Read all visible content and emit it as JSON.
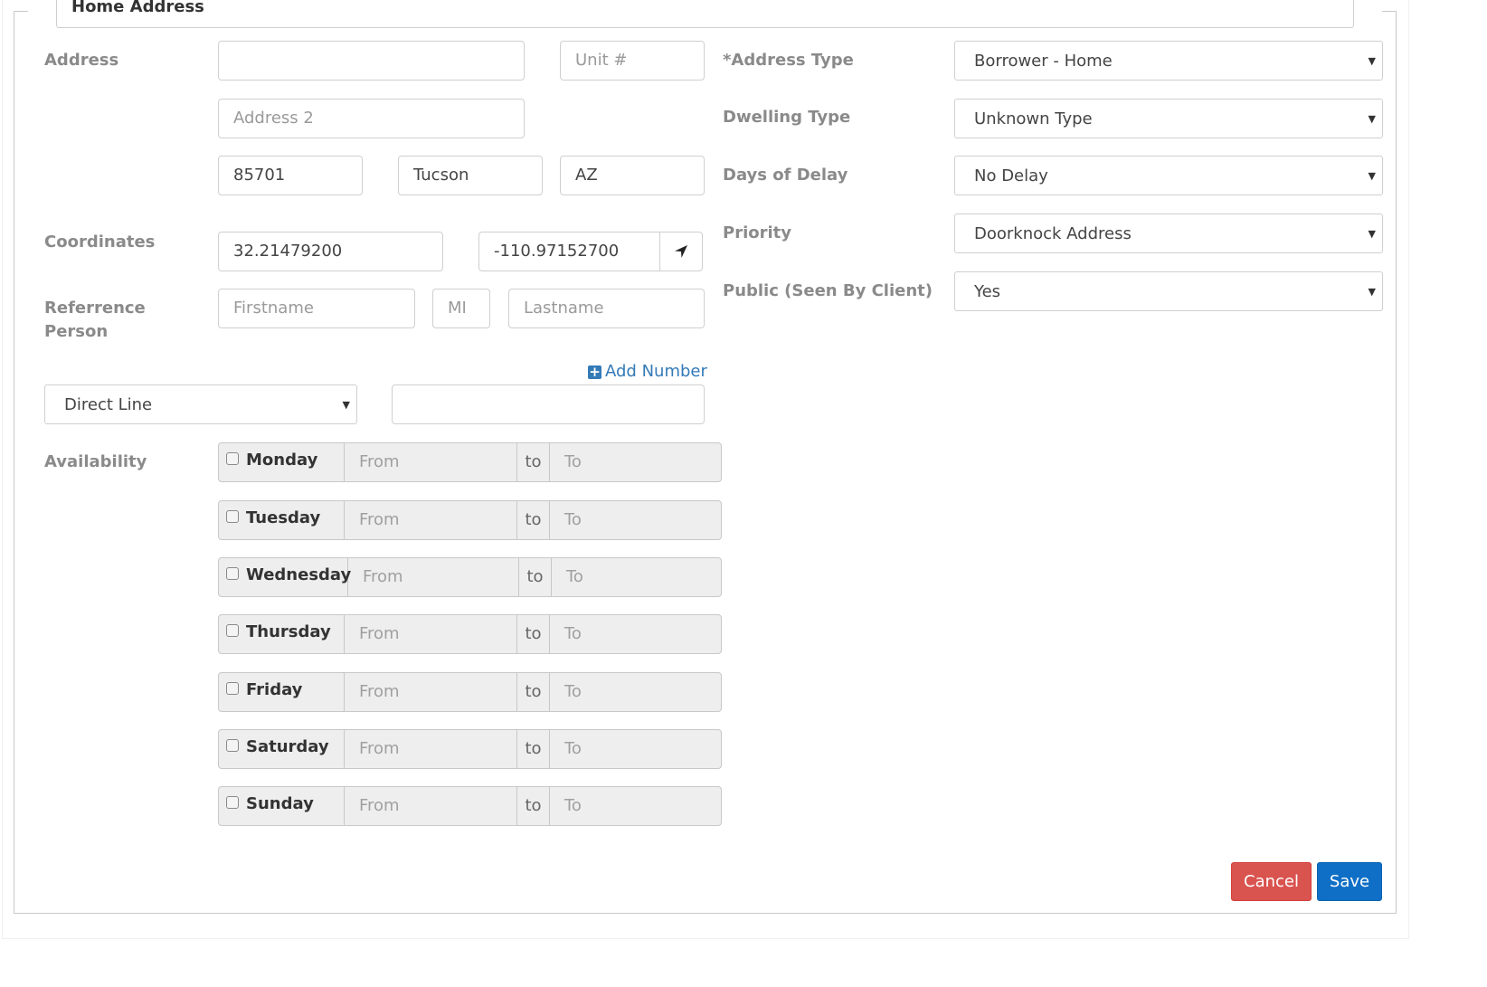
{
  "section": {
    "title": "Home Address"
  },
  "address": {
    "label": "Address",
    "line1_value": "",
    "unit_placeholder": "Unit #",
    "line2_placeholder": "Address 2",
    "zip": "85701",
    "city": "Tucson",
    "state": "AZ"
  },
  "coordinates": {
    "label": "Coordinates",
    "lat": "32.21479200",
    "lng": "-110.97152700",
    "locate_icon": "location-arrow-icon"
  },
  "reference_person": {
    "label_line1": "Referrence",
    "label_line2": "Person",
    "first_placeholder": "Firstname",
    "mi_placeholder": "MI",
    "last_placeholder": "Lastname"
  },
  "phone": {
    "add_number_label": "Add Number",
    "add_icon": "plus-square-icon",
    "type_selected": "Direct Line",
    "number_value": ""
  },
  "availability": {
    "label": "Availability",
    "from_placeholder": "From",
    "to_label": "to",
    "to_placeholder": "To",
    "days": [
      "Monday",
      "Tuesday",
      "Wednesday",
      "Thursday",
      "Friday",
      "Saturday",
      "Sunday"
    ]
  },
  "right_fields": {
    "address_type": {
      "label": "*Address Type",
      "value": "Borrower - Home"
    },
    "dwelling_type": {
      "label": "Dwelling Type",
      "value": "Unknown Type"
    },
    "days_of_delay": {
      "label": "Days of Delay",
      "value": "No Delay"
    },
    "priority": {
      "label": "Priority",
      "value": "Doorknock Address"
    },
    "public": {
      "label": "Public (Seen By Client)",
      "value": "Yes"
    }
  },
  "actions": {
    "cancel": "Cancel",
    "save": "Save"
  },
  "colors": {
    "cancel_bg": "#d9534f",
    "save_bg": "#0f6fc6",
    "link": "#337ab7"
  }
}
